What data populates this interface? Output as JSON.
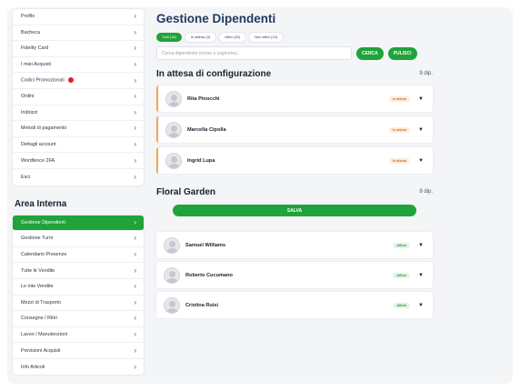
{
  "sidebar": {
    "account_items": [
      {
        "label": "Profilo",
        "badge": false
      },
      {
        "label": "Bacheca",
        "badge": false
      },
      {
        "label": "Fidelity Card",
        "badge": false
      },
      {
        "label": "I miei Acquisti",
        "badge": false
      },
      {
        "label": "Codici Promozionali",
        "badge": true
      },
      {
        "label": "Ordini",
        "badge": false
      },
      {
        "label": "Indirizzi",
        "badge": false
      },
      {
        "label": "Metodi di pagamento",
        "badge": false
      },
      {
        "label": "Dettagli account",
        "badge": false
      },
      {
        "label": "Wordfence 2FA",
        "badge": false
      },
      {
        "label": "Esci",
        "badge": false
      }
    ],
    "area_title": "Area Interna",
    "area_items": [
      {
        "label": "Gestione Dipendenti",
        "active": true
      },
      {
        "label": "Gestione Turni",
        "active": false
      },
      {
        "label": "Calendario Presenze",
        "active": false
      },
      {
        "label": "Tutte le Vendite",
        "active": false
      },
      {
        "label": "Le mie Vendite",
        "active": false
      },
      {
        "label": "Mezzi di Trasporto",
        "active": false
      },
      {
        "label": "Consegne / Ritiri",
        "active": false
      },
      {
        "label": "Lavori / Manutenzioni",
        "active": false
      },
      {
        "label": "Previsioni Acquisti",
        "active": false
      },
      {
        "label": "Info Articoli",
        "active": false
      }
    ],
    "chevron": "›",
    "colors": {
      "active_bg": "#1fa33a",
      "badge_dot": "#e11d2e"
    }
  },
  "main": {
    "title": "Gestione Dipendenti",
    "tabs": [
      {
        "label": "Tutti (16)",
        "active": true
      },
      {
        "label": "In attesa (3)",
        "active": false
      },
      {
        "label": "Attivi (30)",
        "active": false
      },
      {
        "label": "Non attivi (13)",
        "active": false
      }
    ],
    "search": {
      "placeholder": "Cerca dipendente (nome o cognome)...",
      "value": "",
      "search_button": "CERCA",
      "clear_button": "PULISCI"
    },
    "pending_section": {
      "title": "In attesa di configurazione",
      "count": "9 dip.",
      "employees": [
        {
          "name": "Rita Pinocchi",
          "status": "In attesa"
        },
        {
          "name": "Marcella Cipolla",
          "status": "In attesa"
        },
        {
          "name": "Ingrid Lupa",
          "status": "In attesa"
        }
      ]
    },
    "store_section": {
      "title": "Floral Garden",
      "count": "9 dip.",
      "save_button": "SALVA",
      "employees": [
        {
          "name": "Samuel Williams",
          "status": "Attivo"
        },
        {
          "name": "Roberto Cucumano",
          "status": "Attivo"
        },
        {
          "name": "Cristina Ruisi",
          "status": "Attivo"
        }
      ]
    },
    "dropdown_caret": "▼",
    "colors": {
      "accent": "#1fa33a",
      "title": "#1e3a5f",
      "pending": "#f0a94a"
    }
  }
}
